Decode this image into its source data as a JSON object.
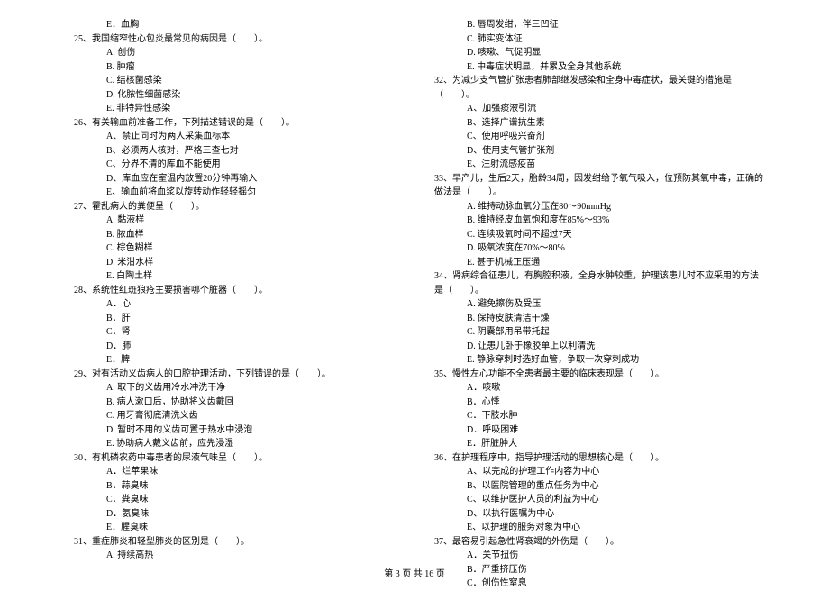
{
  "footer": "第 3 页 共 16 页",
  "left": [
    {
      "t": "opt",
      "v": "E．血胸"
    },
    {
      "t": "q",
      "v": "25、我国缩窄性心包炎最常见的病因是（　　）。"
    },
    {
      "t": "opt",
      "v": "A. 创伤"
    },
    {
      "t": "opt",
      "v": "B. 肿瘤"
    },
    {
      "t": "opt",
      "v": "C. 结核菌感染"
    },
    {
      "t": "opt",
      "v": "D. 化脓性细菌感染"
    },
    {
      "t": "opt",
      "v": "E. 非特异性感染"
    },
    {
      "t": "q",
      "v": "26、有关输血前准备工作，下列描述错误的是（　　）。"
    },
    {
      "t": "opt",
      "v": "A、禁止同时为两人采集血标本"
    },
    {
      "t": "opt",
      "v": "B、必须两人核对，严格三查七对"
    },
    {
      "t": "opt",
      "v": "C、分界不清的库血不能使用"
    },
    {
      "t": "opt",
      "v": "D、库血应在室温内放置20分钟再输入"
    },
    {
      "t": "opt",
      "v": "E、输血前将血浆以旋转动作轻轻摇匀"
    },
    {
      "t": "q",
      "v": "27、霍乱病人的粪便呈（　　）。"
    },
    {
      "t": "opt",
      "v": "A. 黏液样"
    },
    {
      "t": "opt",
      "v": "B. 脓血样"
    },
    {
      "t": "opt",
      "v": "C. 棕色糊样"
    },
    {
      "t": "opt",
      "v": "D. 米泔水样"
    },
    {
      "t": "opt",
      "v": "E. 白陶土样"
    },
    {
      "t": "q",
      "v": "28、系统性红斑狼疮主要损害哪个脏器（　　）。"
    },
    {
      "t": "opt",
      "v": "A．心"
    },
    {
      "t": "opt",
      "v": "B．肝"
    },
    {
      "t": "opt",
      "v": "C．肾"
    },
    {
      "t": "opt",
      "v": "D．肺"
    },
    {
      "t": "opt",
      "v": "E．脾"
    },
    {
      "t": "q",
      "v": "29、对有活动义齿病人的口腔护理活动，下列错误的是（　　）。"
    },
    {
      "t": "opt",
      "v": "A. 取下的义齿用冷水冲洗干净"
    },
    {
      "t": "opt",
      "v": "B. 病人漱口后，协助将义齿戴回"
    },
    {
      "t": "opt",
      "v": "C. 用牙膏彻底清洗义齿"
    },
    {
      "t": "opt",
      "v": "D. 暂时不用的义齿可置于热水中浸泡"
    },
    {
      "t": "opt",
      "v": "E. 协助病人戴义齿前，应先浸湿"
    },
    {
      "t": "q",
      "v": "30、有机磷农药中毒患者的尿液气味呈（　　）。"
    },
    {
      "t": "opt",
      "v": "A．烂苹果味"
    },
    {
      "t": "opt",
      "v": "B．蒜臭味"
    },
    {
      "t": "opt",
      "v": "C．粪臭味"
    },
    {
      "t": "opt",
      "v": "D．氨臭味"
    },
    {
      "t": "opt",
      "v": "E．腥臭味"
    },
    {
      "t": "q",
      "v": "31、重症肺炎和轻型肺炎的区别是（　　）。"
    },
    {
      "t": "opt",
      "v": "A. 持续高热"
    }
  ],
  "right": [
    {
      "t": "opt",
      "v": "B. 唇周发绀，伴三凹征"
    },
    {
      "t": "opt",
      "v": "C. 肺实变体征"
    },
    {
      "t": "opt",
      "v": "D. 咳嗽、气促明显"
    },
    {
      "t": "opt",
      "v": "E. 中毒症状明显，并累及全身其他系统"
    },
    {
      "t": "q",
      "v": "32、为减少支气管扩张患者肺部继发感染和全身中毒症状，最关键的措施是（　　）。"
    },
    {
      "t": "opt",
      "v": "A、加强痰液引流"
    },
    {
      "t": "opt",
      "v": "B、选择广谱抗生素"
    },
    {
      "t": "opt",
      "v": "C、使用呼吸兴奋剂"
    },
    {
      "t": "opt",
      "v": "D、使用支气管扩张剂"
    },
    {
      "t": "opt",
      "v": "E、注射流感疫苗"
    },
    {
      "t": "q",
      "v": "33、早产儿，生后2天，胎龄34周，因发绀给予氧气吸入，位预防其氧中毒，正确的做法是（　　）。"
    },
    {
      "t": "opt",
      "v": "A. 维持动脉血氧分压在80～90mmHg"
    },
    {
      "t": "opt",
      "v": "B. 维持经皮血氧饱和度在85%～93%"
    },
    {
      "t": "opt",
      "v": "C. 连续吸氧时间不超过7天"
    },
    {
      "t": "opt",
      "v": "D. 吸氧浓度在70%～80%"
    },
    {
      "t": "opt",
      "v": "E. 甚于机械正压通"
    },
    {
      "t": "q",
      "v": "34、肾病综合征患儿，有胸腔积液，全身水肿较重，护理该患儿时不应采用的方法是（　　）。"
    },
    {
      "t": "opt",
      "v": "A. 避免擦伤及受压"
    },
    {
      "t": "opt",
      "v": "B. 保持皮肤清洁干燥"
    },
    {
      "t": "opt",
      "v": "C. 阴囊部用吊带托起"
    },
    {
      "t": "opt",
      "v": "D. 让患儿卧于橡胶单上以利清洗"
    },
    {
      "t": "opt",
      "v": "E. 静脉穿刺时选好血管，争取一次穿刺成功"
    },
    {
      "t": "q",
      "v": "35、慢性左心功能不全患者最主要的临床表现是（　　）。"
    },
    {
      "t": "opt",
      "v": "A．咳嗽"
    },
    {
      "t": "opt",
      "v": "B．心悸"
    },
    {
      "t": "opt",
      "v": "C．下肢水肿"
    },
    {
      "t": "opt",
      "v": "D．呼吸困难"
    },
    {
      "t": "opt",
      "v": "E．肝脏肿大"
    },
    {
      "t": "q",
      "v": "36、在护理程序中，指导护理活动的思想核心是（　　）。"
    },
    {
      "t": "opt",
      "v": "A、以完成的护理工作内容为中心"
    },
    {
      "t": "opt",
      "v": "B、以医院管理的重点任务为中心"
    },
    {
      "t": "opt",
      "v": "C、以维护医护人员的利益为中心"
    },
    {
      "t": "opt",
      "v": "D、以执行医嘱为中心"
    },
    {
      "t": "opt",
      "v": "E、以护理的服务对象为中心"
    },
    {
      "t": "q",
      "v": "37、最容易引起急性肾衰竭的外伤是（　　）。"
    },
    {
      "t": "opt",
      "v": "A．关节扭伤"
    },
    {
      "t": "opt",
      "v": "B．严重挤压伤"
    },
    {
      "t": "opt",
      "v": "C．创伤性窒息"
    }
  ]
}
